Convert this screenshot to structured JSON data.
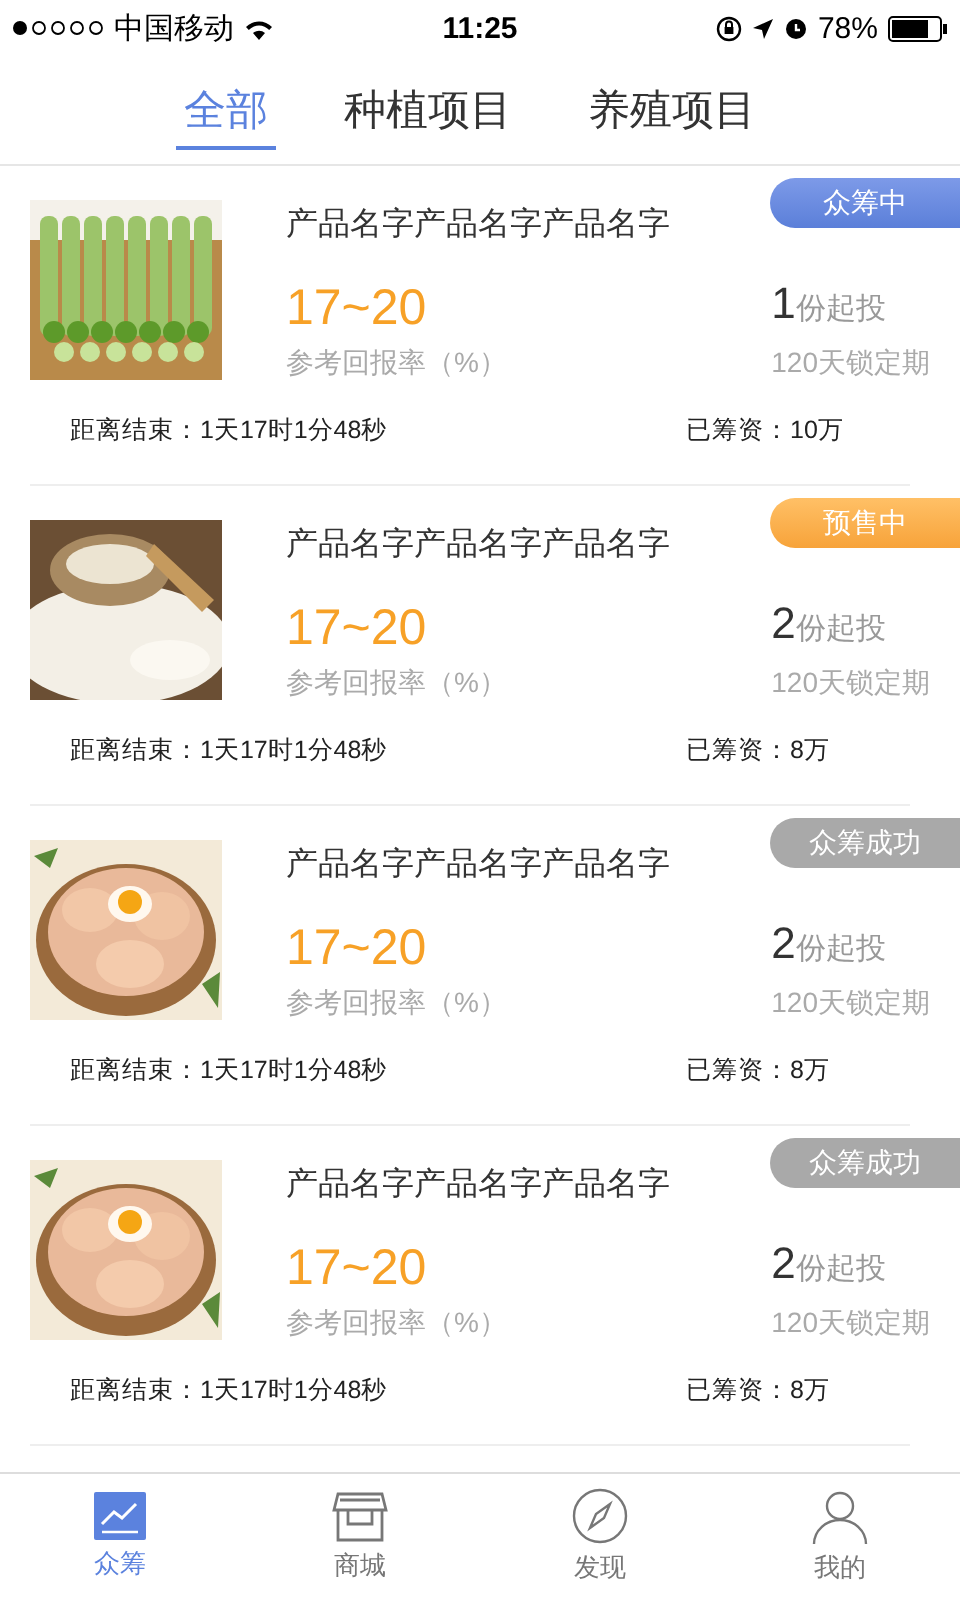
{
  "status_bar": {
    "carrier": "中国移动",
    "time": "11:25",
    "battery": "78%"
  },
  "tabs": [
    {
      "label": "全部",
      "selected": true
    },
    {
      "label": "种植项目",
      "selected": false
    },
    {
      "label": "养殖项目",
      "selected": false
    }
  ],
  "projects": [
    {
      "name": "产品名字产品名字产品名字",
      "badge": {
        "kind": "raising",
        "label": "众筹中"
      },
      "rate": "17~20",
      "rate_label": "参考回报率（%）",
      "min_count": "1",
      "min_unit": "份起投",
      "lock": "120天锁定期",
      "countdown": "距离结束：1天17时1分48秒",
      "raised": "已筹资：10万"
    },
    {
      "name": "产品名字产品名字产品名字",
      "badge": {
        "kind": "presale",
        "label": "预售中"
      },
      "rate": "17~20",
      "rate_label": "参考回报率（%）",
      "min_count": "2",
      "min_unit": "份起投",
      "lock": "120天锁定期",
      "countdown": "距离结束：1天17时1分48秒",
      "raised": "已筹资：8万"
    },
    {
      "name": "产品名字产品名字产品名字",
      "badge": {
        "kind": "success",
        "label": "众筹成功"
      },
      "rate": "17~20",
      "rate_label": "参考回报率（%）",
      "min_count": "2",
      "min_unit": "份起投",
      "lock": "120天锁定期",
      "countdown": "距离结束：1天17时1分48秒",
      "raised": "已筹资：8万"
    },
    {
      "name": "产品名字产品名字产品名字",
      "badge": {
        "kind": "success",
        "label": "众筹成功"
      },
      "rate": "17~20",
      "rate_label": "参考回报率（%）",
      "min_count": "2",
      "min_unit": "份起投",
      "lock": "120天锁定期",
      "countdown": "距离结束：1天17时1分48秒",
      "raised": "已筹资：8万"
    }
  ],
  "bottom_nav": [
    {
      "label": "众筹",
      "kind": "chart",
      "selected": true
    },
    {
      "label": "商城",
      "kind": "store",
      "selected": false
    },
    {
      "label": "发现",
      "kind": "compass",
      "selected": false
    },
    {
      "label": "我的",
      "kind": "person",
      "selected": false
    }
  ]
}
